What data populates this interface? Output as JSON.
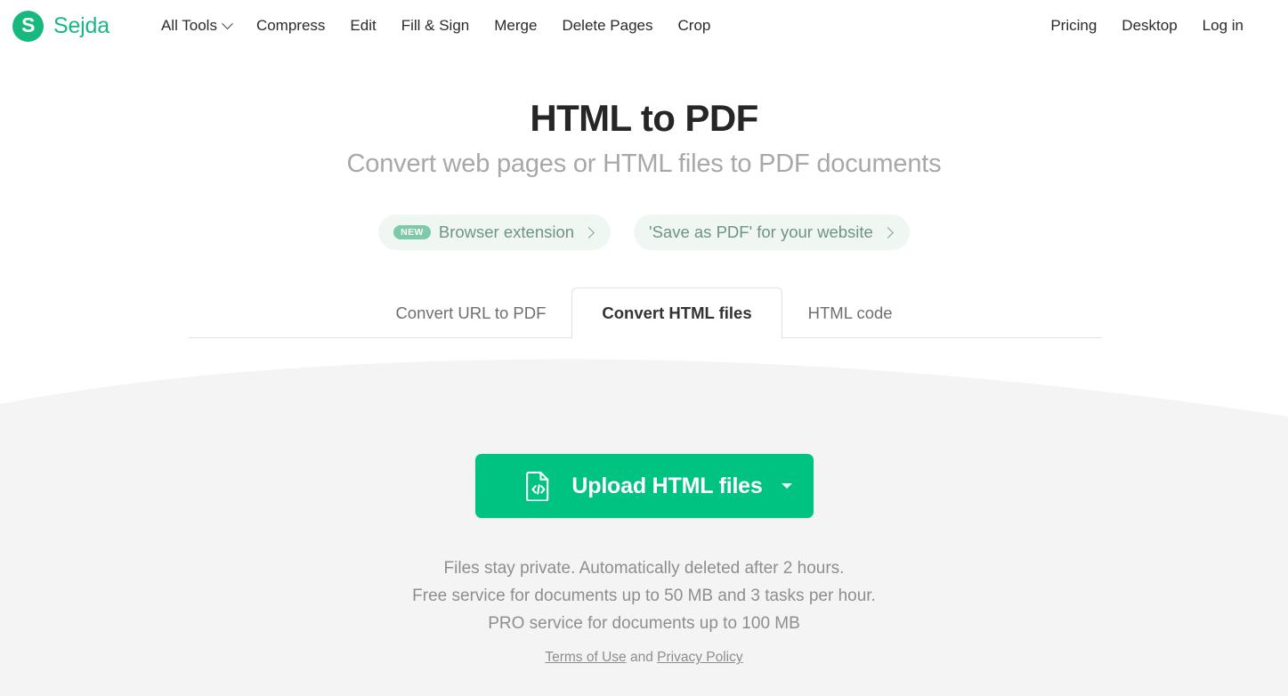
{
  "header": {
    "brand": {
      "mark_letter": "S",
      "name": "Sejda",
      "icon": "sejda-logo-icon"
    },
    "nav_main": [
      {
        "label": "All Tools",
        "has_chevron": true
      },
      {
        "label": "Compress",
        "has_chevron": false
      },
      {
        "label": "Edit",
        "has_chevron": false
      },
      {
        "label": "Fill & Sign",
        "has_chevron": false
      },
      {
        "label": "Merge",
        "has_chevron": false
      },
      {
        "label": "Delete Pages",
        "has_chevron": false
      },
      {
        "label": "Crop",
        "has_chevron": false
      }
    ],
    "nav_right": [
      {
        "label": "Pricing"
      },
      {
        "label": "Desktop"
      },
      {
        "label": "Log in"
      }
    ]
  },
  "hero": {
    "title": "HTML to PDF",
    "subtitle": "Convert web pages or HTML files to PDF documents"
  },
  "promos": [
    {
      "badge": "NEW",
      "label": "Browser extension",
      "has_badge": true
    },
    {
      "badge": "",
      "label": "'Save as PDF' for your website",
      "has_badge": false
    }
  ],
  "tabs": [
    {
      "label": "Convert URL to PDF",
      "active": false
    },
    {
      "label": "Convert HTML files",
      "active": true
    },
    {
      "label": "HTML code",
      "active": false
    }
  ],
  "upload": {
    "label": "Upload HTML files",
    "icon": "file-code-icon",
    "dropdown_icon": "caret-down-icon"
  },
  "notes": {
    "line1": "Files stay private. Automatically deleted after 2 hours.",
    "line2": "Free service for documents up to 50 MB and 3 tasks per hour.",
    "line3": "PRO service for documents up to 100 MB"
  },
  "legal": {
    "terms": "Terms of Use",
    "conjunction": " and ",
    "privacy": "Privacy Policy"
  },
  "colors": {
    "brand_green": "#18b97f",
    "button_green": "#00c281",
    "badge_green": "#7dcaa9",
    "panel_gray": "#f4f4f4",
    "muted_text": "#8e8e8e"
  }
}
